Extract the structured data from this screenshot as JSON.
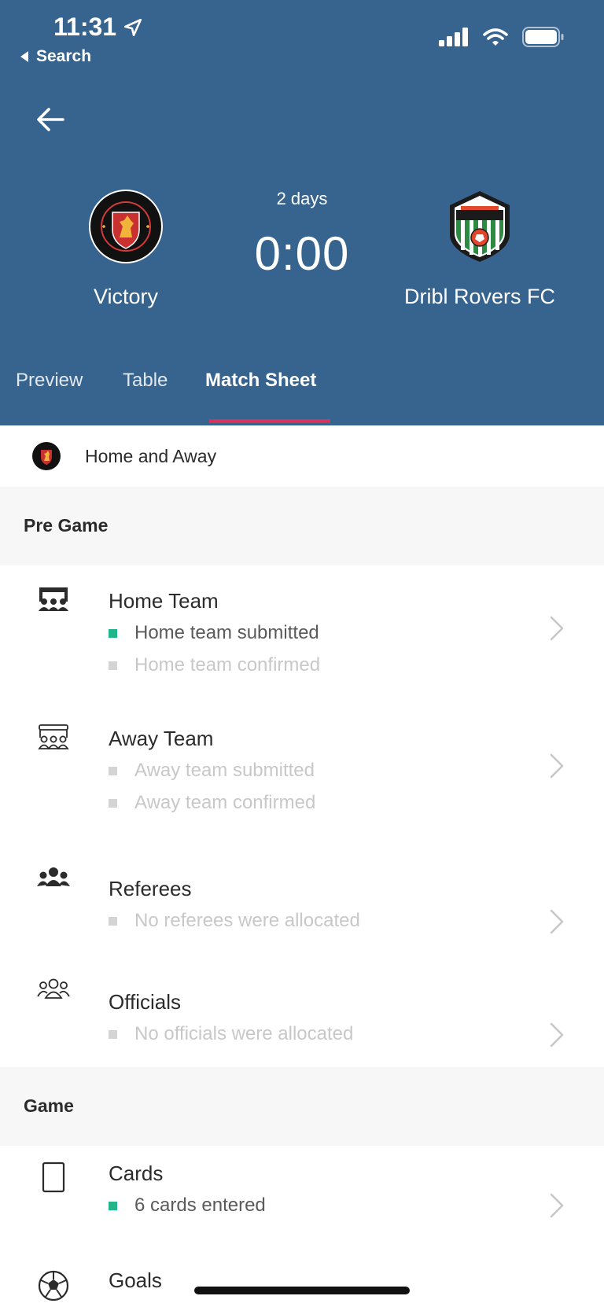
{
  "status_bar": {
    "time": "11:31",
    "back_label": "Search"
  },
  "match": {
    "countdown": "2 days",
    "score": "0:00",
    "home_team": {
      "name": "Victory",
      "logo_icon": "victory-crest-icon"
    },
    "away_team": {
      "name": "Dribl Rovers FC",
      "logo_icon": "rovers-crest-icon"
    }
  },
  "tabs": [
    {
      "label": "Preview",
      "active": false
    },
    {
      "label": "Table",
      "active": false
    },
    {
      "label": "Match Sheet",
      "active": true
    }
  ],
  "competition": {
    "label": "Home and Away"
  },
  "sections": {
    "pre_game": {
      "title": "Pre Game",
      "items": [
        {
          "title": "Home Team",
          "icon": "team-filled-icon",
          "lines": [
            {
              "text": "Home team submitted",
              "done": true
            },
            {
              "text": "Home team confirmed",
              "done": false
            }
          ]
        },
        {
          "title": "Away Team",
          "icon": "team-outline-icon",
          "lines": [
            {
              "text": "Away team submitted",
              "done": false
            },
            {
              "text": "Away team confirmed",
              "done": false
            }
          ]
        },
        {
          "title": "Referees",
          "icon": "users-filled-icon",
          "lines": [
            {
              "text": "No referees were allocated",
              "done": false
            }
          ]
        },
        {
          "title": "Officials",
          "icon": "users-outline-icon",
          "lines": [
            {
              "text": "No officials were allocated",
              "done": false
            }
          ]
        }
      ]
    },
    "game": {
      "title": "Game",
      "items": [
        {
          "title": "Cards",
          "icon": "card-icon",
          "lines": [
            {
              "text": "6 cards entered",
              "done": true
            }
          ]
        },
        {
          "title": "Goals",
          "icon": "soccer-ball-icon",
          "lines": []
        }
      ]
    }
  },
  "colors": {
    "header_bg": "#37648e",
    "tab_accent": "#d6325a",
    "done_green": "#23b58a",
    "pending_gray": "#d4d4d4"
  }
}
